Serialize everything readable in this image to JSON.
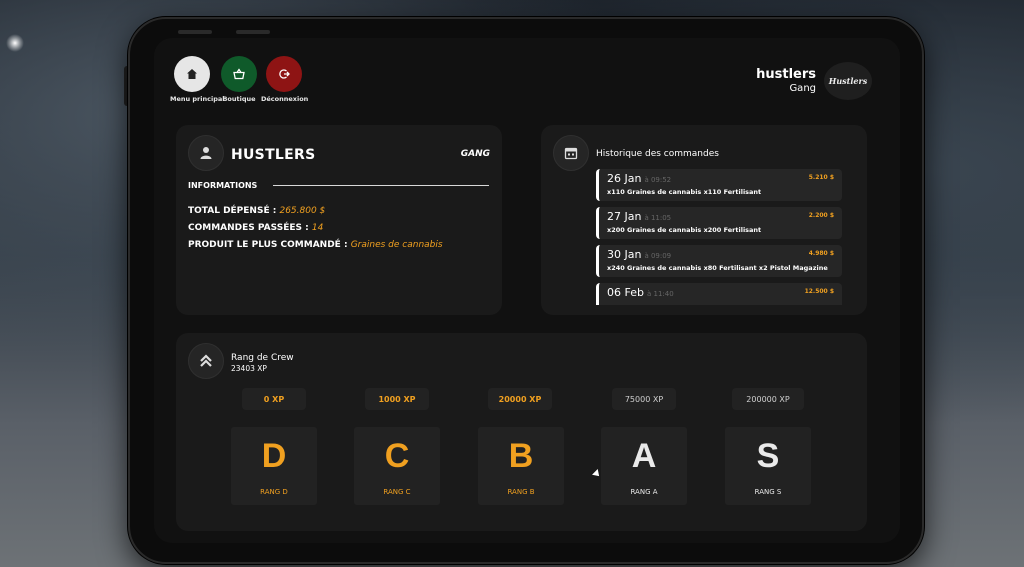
{
  "nav": [
    {
      "label": "Menu principal",
      "icon": "home-icon",
      "color": "#e6e6e6"
    },
    {
      "label": "Boutique",
      "icon": "basket-icon",
      "color": "#0f5a2a"
    },
    {
      "label": "Déconnexion",
      "icon": "logout-icon",
      "color": "#8e1414"
    }
  ],
  "org": {
    "name": "hustlers",
    "type": "Gang",
    "logo": "Hustlers"
  },
  "info": {
    "title": "HUSTLERS",
    "badge": "GANG",
    "section": "INFORMATIONS",
    "stats": [
      {
        "label": "TOTAL DÉPENSÉ : ",
        "value": "265.800 $"
      },
      {
        "label": "COMMANDES PASSÉES : ",
        "value": "14"
      },
      {
        "label": "PRODUIT LE PLUS COMMANDÉ : ",
        "value": "Graines de cannabis"
      }
    ]
  },
  "history": {
    "title": "Historique des commandes",
    "orders": [
      {
        "date": "26 Jan",
        "time": "à 09:52",
        "price": "5.210 $",
        "items": "x110 Graines de cannabis  x110 Fertilisant"
      },
      {
        "date": "27 Jan",
        "time": "à 11:05",
        "price": "2.200 $",
        "items": "x200 Graines de cannabis  x200 Fertilisant"
      },
      {
        "date": "30 Jan",
        "time": "à 09:09",
        "price": "4.980 $",
        "items": "x240 Graines de cannabis  x80 Fertilisant  x2 Pistol Magazine"
      },
      {
        "date": "06 Feb",
        "time": "à 11:40",
        "price": "12.500 $",
        "items": ""
      }
    ]
  },
  "rank": {
    "title": "Rang de Crew",
    "xp": "23403 XP",
    "levels": [
      {
        "xp": "0 XP",
        "letter": "D",
        "label": "RANG D",
        "unlocked": true
      },
      {
        "xp": "1000 XP",
        "letter": "C",
        "label": "RANG C",
        "unlocked": true
      },
      {
        "xp": "20000 XP",
        "letter": "B",
        "label": "RANG B",
        "unlocked": true
      },
      {
        "xp": "75000 XP",
        "letter": "A",
        "label": "RANG A",
        "unlocked": false
      },
      {
        "xp": "200000 XP",
        "letter": "S",
        "label": "RANG S",
        "unlocked": false
      }
    ]
  },
  "colors": {
    "accent": "#f0a020",
    "panel": "#1a1a1a",
    "screen": "#111111"
  }
}
